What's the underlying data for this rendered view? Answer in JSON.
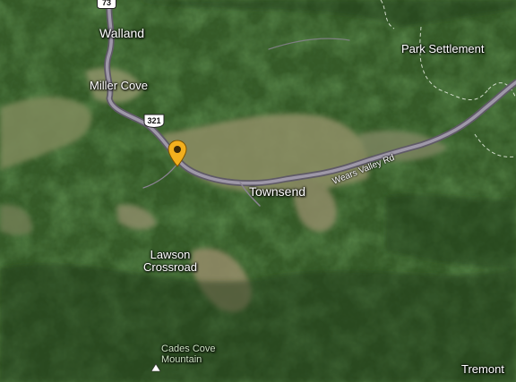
{
  "map": {
    "places": {
      "walland": "Walland",
      "miller_cove": "Miller Cove",
      "park_settlement": "Park Settlement",
      "townsend": "Townsend",
      "lawson_line1": "Lawson",
      "lawson_line2": "Crossroad",
      "cades_line1": "Cades Cove",
      "cades_line2": "Mountain",
      "tremont": "Tremont"
    },
    "roads": {
      "shield_top": "73",
      "shield_mid": "321",
      "wears_valley": "Wears Valley Rd"
    },
    "icons": {
      "pin": "location-pin-icon",
      "peak": "mountain-peak-icon"
    },
    "colors": {
      "pin": "#f2b01e",
      "road": "#8a8392",
      "forest": "#2f5123"
    }
  }
}
